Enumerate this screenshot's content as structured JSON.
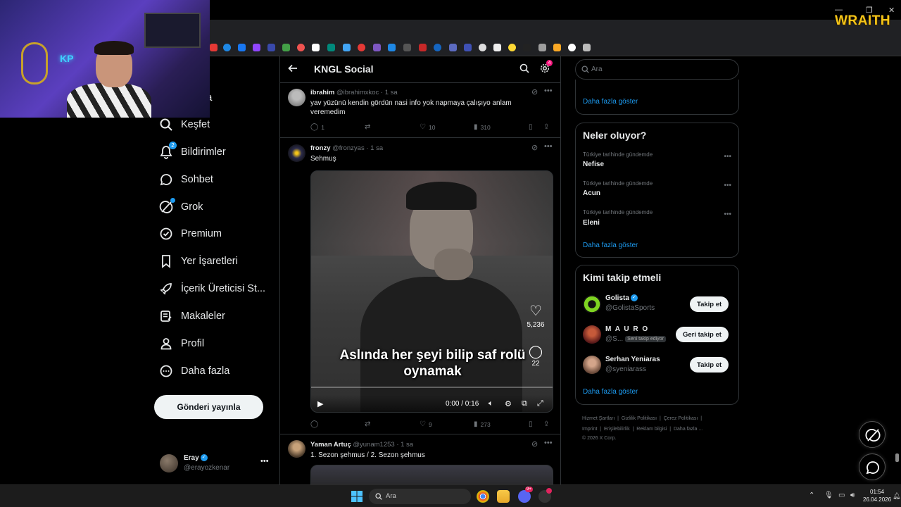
{
  "overlay": {
    "brand": "WRAITH"
  },
  "left_nav": {
    "partial_item": "yfa",
    "items": [
      {
        "label": "Keşfet",
        "icon": "search-icon"
      },
      {
        "label": "Bildirimler",
        "icon": "bell-icon",
        "badge": "2"
      },
      {
        "label": "Sohbet",
        "icon": "chat-icon"
      },
      {
        "label": "Grok",
        "icon": "grok-icon"
      },
      {
        "label": "Premium",
        "icon": "premium-icon"
      },
      {
        "label": "Yer İşaretleri",
        "icon": "bookmark-icon"
      },
      {
        "label": "İçerik Üreticisi St...",
        "icon": "rocket-icon"
      },
      {
        "label": "Makaleler",
        "icon": "article-icon"
      },
      {
        "label": "Profil",
        "icon": "profile-icon"
      },
      {
        "label": "Daha fazla",
        "icon": "more-circle-icon"
      }
    ],
    "post_button": "Gönderi yayınla",
    "account": {
      "name": "Eray",
      "handle": "@erayozkenar"
    }
  },
  "feed": {
    "title": "KNGL Social",
    "settings_badge": "4",
    "tweets": [
      {
        "name": "ibrahim",
        "handle": "@ibrahimxkoc",
        "time": "· 1 sa",
        "text": "yav yüzünü kendin gördün nasi info yok napmaya çalışıyo anlam veremedim",
        "replies": "1",
        "reposts": "",
        "likes": "10",
        "views": "310"
      },
      {
        "name": "fronzy",
        "handle": "@fronzyas",
        "time": "· 1 sa",
        "text": "Sehmuş",
        "video": {
          "caption_line1": "Aslında her şeyi bilip saf rolü",
          "caption_line2": "oynamak",
          "like_count": "5,236",
          "comment_count": "22",
          "time": "0:00 / 0:16"
        },
        "replies": "",
        "reposts": "",
        "likes": "9",
        "views": "273"
      },
      {
        "name": "Yaman Artuç",
        "handle": "@yunam1253",
        "time": "· 1 sa",
        "text": "1. Sezon şehmus / 2. Sezon şehmus"
      }
    ]
  },
  "right": {
    "search_placeholder": "Ara",
    "top_panel": {
      "more_link": "Daha fazla göster"
    },
    "trends": {
      "title": "Neler oluyor?",
      "items": [
        {
          "context": "Türkiye tarihinde gündemde",
          "name": "Nefise"
        },
        {
          "context": "Türkiye tarihinde gündemde",
          "name": "Acun"
        },
        {
          "context": "Türkiye tarihinde gündemde",
          "name": "Eleni"
        }
      ],
      "more_link": "Daha fazla göster"
    },
    "who_to_follow": {
      "title": "Kimi takip etmeli",
      "items": [
        {
          "name": "Golista",
          "handle": "@GolistaSports",
          "button": "Takip et",
          "verified": true
        },
        {
          "name": "M A U R O",
          "handle": "@S...",
          "follows_you": "Seni takip ediyor",
          "button": "Geri takip et"
        },
        {
          "name": "Serhan Yeniaras",
          "handle": "@syeniarass",
          "button": "Takip et"
        }
      ],
      "more_link": "Daha fazla göster"
    },
    "footer": {
      "links": [
        "Hizmet Şartları",
        "Gizlilik Politikası",
        "Çerez Politikası",
        "Imprint",
        "Erişilebilirlik",
        "Reklam bilgisi",
        "Daha fazla ..."
      ],
      "copyright": "© 2026 X Corp."
    }
  },
  "taskbar": {
    "search_placeholder": "Ara",
    "time": "01:54",
    "date": "26.04.2026",
    "discord_badge": "9+"
  },
  "colors": {
    "accent": "#1d9bf0",
    "background": "#000000",
    "text": "#e7e9ea",
    "muted": "#71767b",
    "border": "#2f3336",
    "wraith": "#f5c518"
  }
}
